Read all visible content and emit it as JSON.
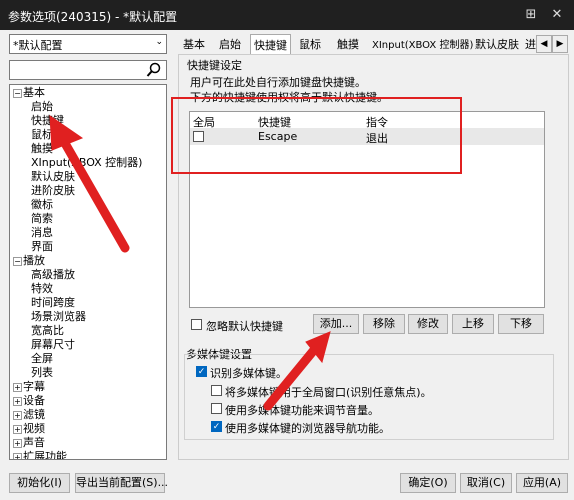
{
  "window": {
    "title": "参数选项(240315) - *默认配置",
    "pin": "⊞",
    "close": "✕"
  },
  "profile": {
    "value": "*默认配置",
    "arrow": "⌄"
  },
  "search": {
    "placeholder": "",
    "icon": "search-icon"
  },
  "tree": {
    "basic": "基本",
    "basic_items": [
      "启始",
      "快捷键",
      "鼠标",
      "触摸",
      "XInput(XBOX 控制器)",
      "默认皮肤",
      "进阶皮肤",
      "徽标",
      "简索",
      "消息",
      "界面"
    ],
    "playback": "播放",
    "playback_items": [
      "高级播放",
      "特效",
      "时间跨度",
      "场景浏览器",
      "宽高比",
      "屏幕尺寸",
      "全屏",
      "列表"
    ],
    "others": [
      "字幕",
      "设备",
      "滤镜",
      "视频",
      "声音",
      "扩展功能"
    ]
  },
  "tabs": [
    "基本",
    "启始",
    "快捷键",
    "鼠标",
    "触摸",
    "XInput(XBOX 控制器)",
    "默认皮肤",
    "进"
  ],
  "tab_nav": {
    "left": "◀",
    "right": "▶"
  },
  "hotkey_group": {
    "title": "快捷键设定",
    "desc1": "用户可在此处自行添加键盘快捷键。",
    "desc2": "下方的快捷键使用权将高于默认快捷键。",
    "columns": [
      "全局",
      "快捷键",
      "指令"
    ],
    "rows": [
      {
        "global": false,
        "key": "Escape",
        "command": "退出"
      }
    ],
    "ignore_default": "忽略默认快捷键",
    "buttons": {
      "add": "添加...",
      "remove": "移除",
      "edit": "修改",
      "up": "上移",
      "down": "下移"
    }
  },
  "media_group": {
    "title": "多媒体键设置",
    "options": [
      {
        "label": "识别多媒体键。",
        "checked": true
      },
      {
        "label": "将多媒体键用于全局窗口(识别任意焦点)。",
        "checked": false
      },
      {
        "label": "使用多媒体键功能来调节音量。",
        "checked": false
      },
      {
        "label": "使用多媒体键的浏览器导航功能。",
        "checked": true
      }
    ]
  },
  "footer": {
    "init": "初始化(I)",
    "export": "导出当前配置(S)...",
    "ok": "确定(O)",
    "cancel": "取消(C)",
    "apply": "应用(A)"
  },
  "colors": {
    "annotation": "#e02020",
    "accent": "#0067c0"
  }
}
